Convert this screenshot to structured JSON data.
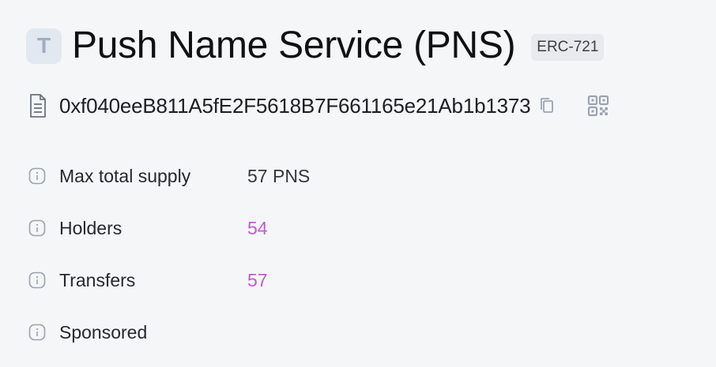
{
  "token": {
    "avatar_letter": "T",
    "name": "Push Name Service (PNS)",
    "standard": "ERC-721",
    "address": "0xf040eeB811A5fE2F5618B7F661165e21Ab1b1373"
  },
  "details": [
    {
      "label": "Max total supply",
      "value": "57 PNS"
    },
    {
      "label": "Holders",
      "value": "54"
    },
    {
      "label": "Transfers",
      "value": "57"
    },
    {
      "label": "Sponsored",
      "value": ""
    }
  ],
  "colors": {
    "link": "#c25ad0",
    "background": "#f5f6f8"
  },
  "icons": [
    "document-icon",
    "copy-icon",
    "qr-code-icon",
    "info-icon"
  ]
}
